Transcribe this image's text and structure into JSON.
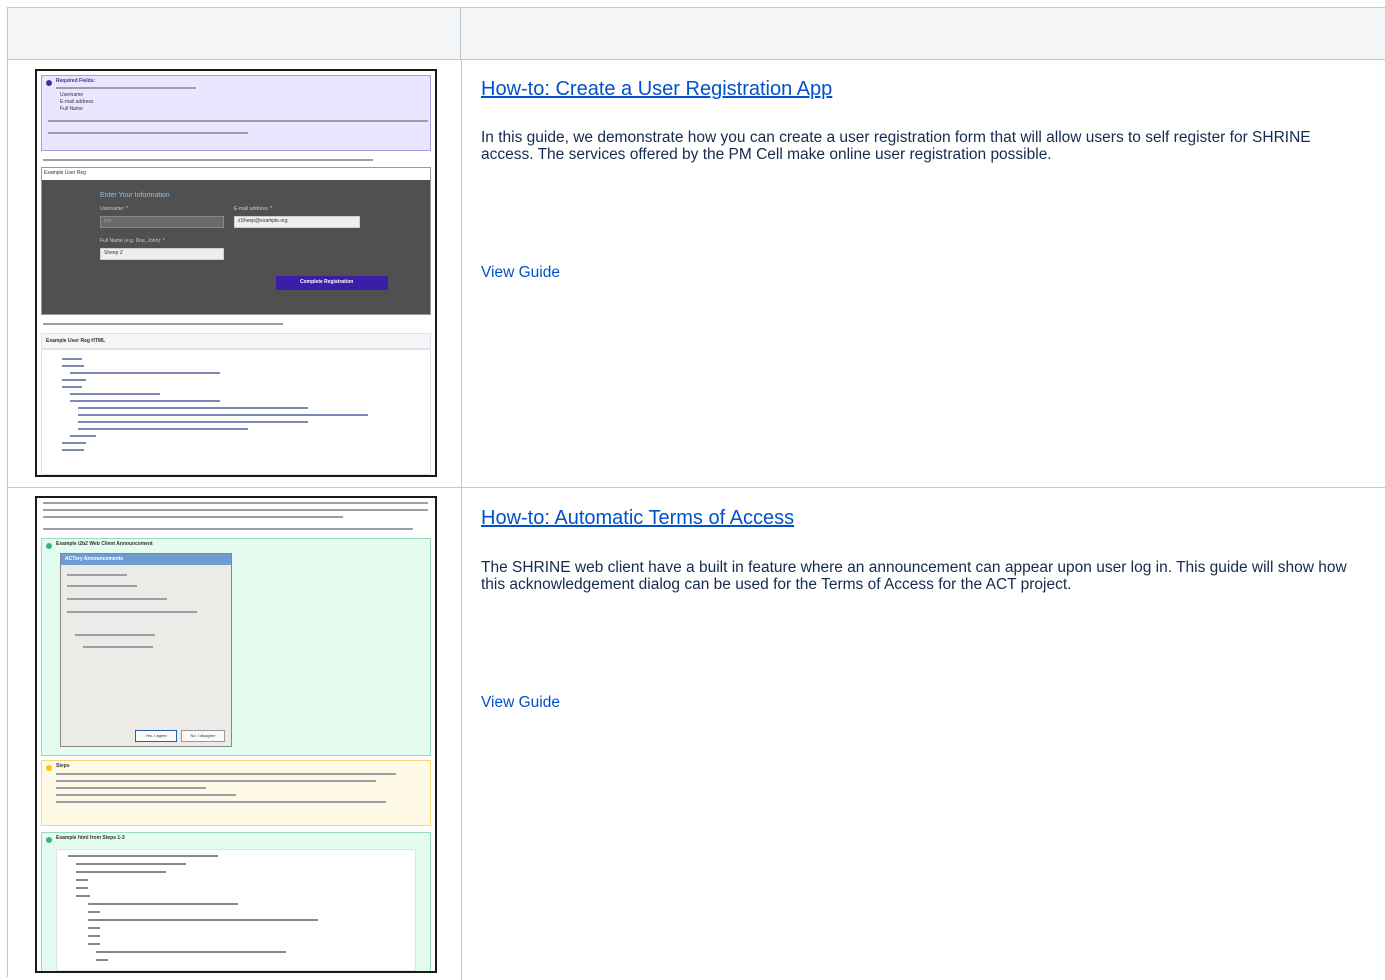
{
  "guides": [
    {
      "title": "How-to: Create a User Registration App",
      "description": "In this guide, we demonstrate how you can create a user registration form that will allow users to self register for SHRINE access.  The services offered by the PM Cell make online user registration possible.",
      "link_label": "View Guide",
      "thumbnail": {
        "notice_title": "Required Fields:",
        "notice_items": [
          "Username",
          "E-mail address",
          "Full Name"
        ],
        "panel_title": "Example User Reg",
        "form_heading": "Enter Your Information",
        "username_label": "Username: *",
        "username_value": "zzz",
        "email_label": "E-mail address: *",
        "email_value": "zSheep@example.org",
        "fullname_label": "Full Name (e.g. Doe, John): *",
        "fullname_value": "Sheep Z",
        "submit_label": "Complete Registration",
        "code_title": "Example User Reg HTML"
      }
    },
    {
      "title": "How-to: Automatic Terms of Access",
      "description": "The SHRINE web client have a built in feature where an announcement can appear upon user log in. This guide will show how this acknowledgement dialog can be used for the Terms of Access for the ACT project.",
      "link_label": "View Guide",
      "thumbnail": {
        "panel1_title": "Example i2b2 Web Client Announcement",
        "dialog_title": "ACTory Announcements",
        "btn_agree": "Yes, I agree",
        "btn_disagree": "No, I disagree",
        "steps_title": "Steps",
        "panel3_title": "Example html from Steps 1-3"
      }
    }
  ]
}
